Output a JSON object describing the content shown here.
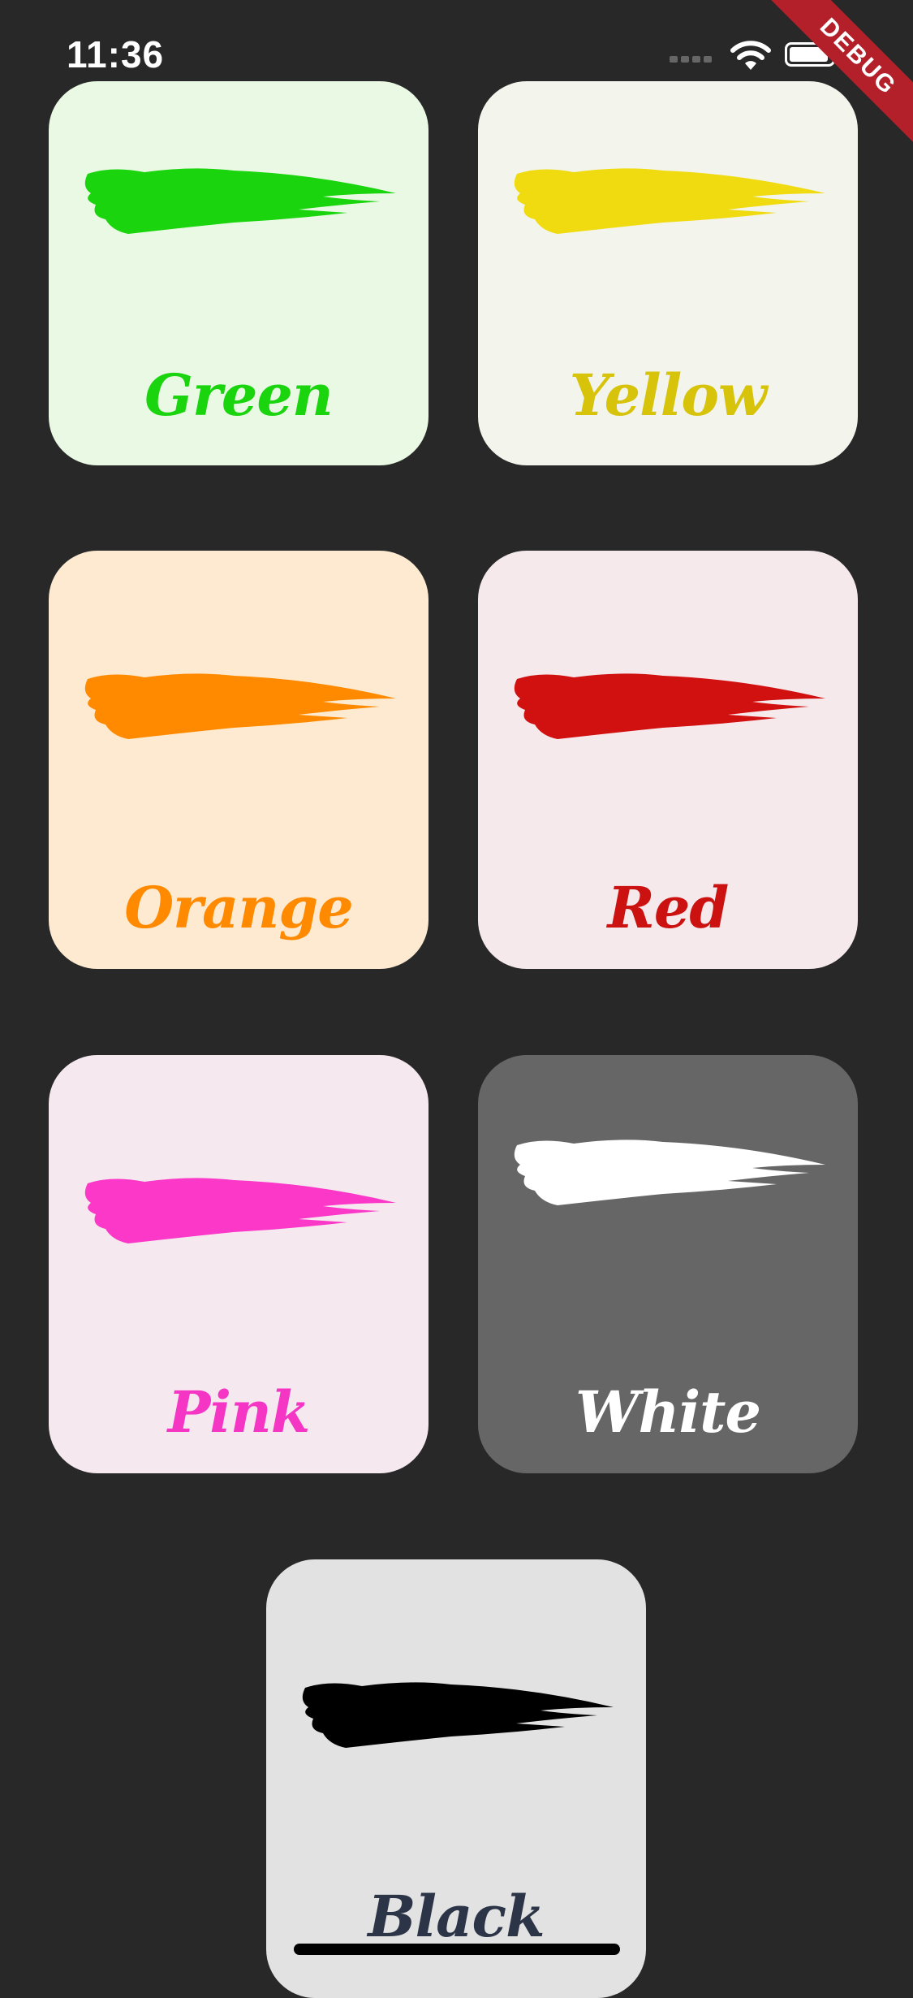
{
  "status_bar": {
    "time": "11:36"
  },
  "debug_banner": {
    "label": "DEBUG"
  },
  "colors": [
    {
      "label": "Green",
      "text_color": "#1ad40e",
      "paint_color": "#1ad40e",
      "card_bg": "#e9f9e4"
    },
    {
      "label": "Yellow",
      "text_color": "#d6c30a",
      "paint_color": "#efdb10",
      "card_bg": "#f3f4ec"
    },
    {
      "label": "Orange",
      "text_color": "#ff8a00",
      "paint_color": "#ff8a00",
      "card_bg": "#fdead0"
    },
    {
      "label": "Red",
      "text_color": "#cc1111",
      "paint_color": "#d11010",
      "card_bg": "#f5e9ec"
    },
    {
      "label": "Pink",
      "text_color": "#f536c5",
      "paint_color": "#fb38c7",
      "card_bg": "#f5e9ef"
    },
    {
      "label": "White",
      "text_color": "#ffffff",
      "paint_color": "#ffffff",
      "card_bg": "#666666"
    },
    {
      "label": "Black",
      "text_color": "#2c3547",
      "paint_color": "#000000",
      "card_bg": "#e2e2e2"
    }
  ]
}
